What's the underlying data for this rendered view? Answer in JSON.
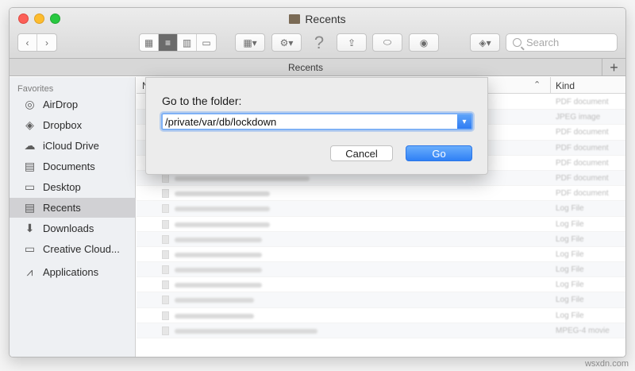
{
  "window": {
    "title": "Recents"
  },
  "toolbar": {
    "search_placeholder": "Search",
    "help_label": "?"
  },
  "tabbar": {
    "tab_label": "Recents",
    "add_label": "+"
  },
  "sidebar": {
    "heading": "Favorites",
    "items": [
      {
        "label": "AirDrop",
        "icon": "airdrop-icon"
      },
      {
        "label": "Dropbox",
        "icon": "dropbox-icon"
      },
      {
        "label": "iCloud Drive",
        "icon": "cloud-icon"
      },
      {
        "label": "Documents",
        "icon": "documents-icon"
      },
      {
        "label": "Desktop",
        "icon": "desktop-icon"
      },
      {
        "label": "Recents",
        "icon": "recents-icon",
        "selected": true
      },
      {
        "label": "Downloads",
        "icon": "downloads-icon"
      },
      {
        "label": "Creative Cloud...",
        "icon": "folder-icon"
      },
      {
        "label": "Applications",
        "icon": "applications-icon"
      }
    ]
  },
  "file_list": {
    "column_name": "N",
    "column_kind": "Kind",
    "kinds": [
      "PDF document",
      "JPEG image",
      "PDF document",
      "PDF document",
      "PDF document",
      "PDF document",
      "PDF document",
      "Log File",
      "Log File",
      "Log File",
      "Log File",
      "Log File",
      "Log File",
      "Log File",
      "Log File",
      "MPEG-4 movie"
    ]
  },
  "dialog": {
    "label": "Go to the folder:",
    "path_value": "/private/var/db/lockdown",
    "cancel_label": "Cancel",
    "go_label": "Go"
  },
  "watermark": "wsxdn.com"
}
